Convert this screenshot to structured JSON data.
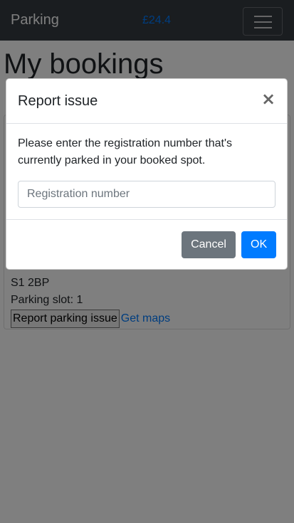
{
  "navbar": {
    "brand": "Parking",
    "balance": "£24.4",
    "menu_icon": "hamburger-menu-icon"
  },
  "page": {
    "title": "My bookings"
  },
  "booking": {
    "postcode": "S1 2BP",
    "slot": "Parking slot: 1",
    "report_label": "Report parking issue",
    "maps_label": "Get maps"
  },
  "modal": {
    "title": "Report issue",
    "close_symbol": "×",
    "message": "Please enter the registration number that's currently parked in your booked spot.",
    "input_value": "",
    "input_placeholder": "Registration number",
    "cancel_label": "Cancel",
    "ok_label": "OK"
  },
  "colors": {
    "navbar_bg": "#343a40",
    "accent": "#007bff",
    "secondary": "#6c757d"
  }
}
